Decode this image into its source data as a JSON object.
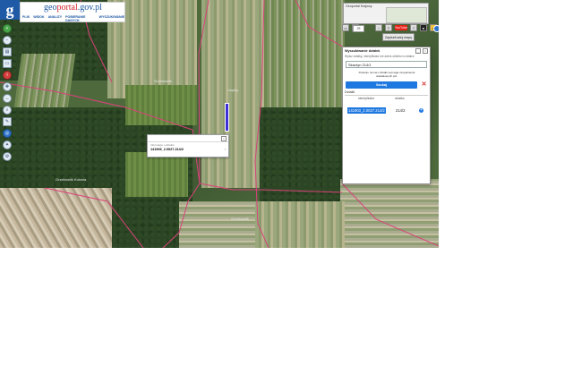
{
  "brand": {
    "name_pre": "geo",
    "name_mid": "portal",
    "name_post": ".gov.pl"
  },
  "menu": [
    "PLIK",
    "WIDOK",
    "ANALIZY",
    "POBIERANIE DANYCH",
    "WYSZUKIWANIE"
  ],
  "map_labels": {
    "village_a": "Grzebowilk",
    "village_b": "Uspiny",
    "village_c": "Grzebowilk",
    "village_d": "Grzebowilk Kolonia"
  },
  "overview": {
    "title": "Geoportal Krajowy"
  },
  "zoom_value": "29",
  "toolbar": {
    "youtube_label": "YouTube",
    "zapisz_label": "Zapisz/Ładuj mapę"
  },
  "popup": {
    "subtitle": "Informacje o działce",
    "parcel_id": "141903_2.0027.214/2"
  },
  "search_panel": {
    "title": "Wyszukiwanie działek",
    "help": "Wpisz działkę, identyfikator lub adres obiektu w działce",
    "query": "Skarżyn 214/1",
    "note": "Podanie numeru działki wymaga uzupełnienia dodatkowych pól.",
    "search_label": "Szukaj",
    "clear_label": "✕",
    "section": "Działki",
    "columns": [
      "identyfikator",
      "działka"
    ],
    "results": [
      {
        "identyfikator": "141903_2.0027.214/2",
        "dzialka": "214/2"
      }
    ]
  },
  "colors": {
    "accent_blue": "#1f78e0",
    "parcel_boundary": "#d9427a",
    "parcel_highlight": "#3b2fd6"
  }
}
